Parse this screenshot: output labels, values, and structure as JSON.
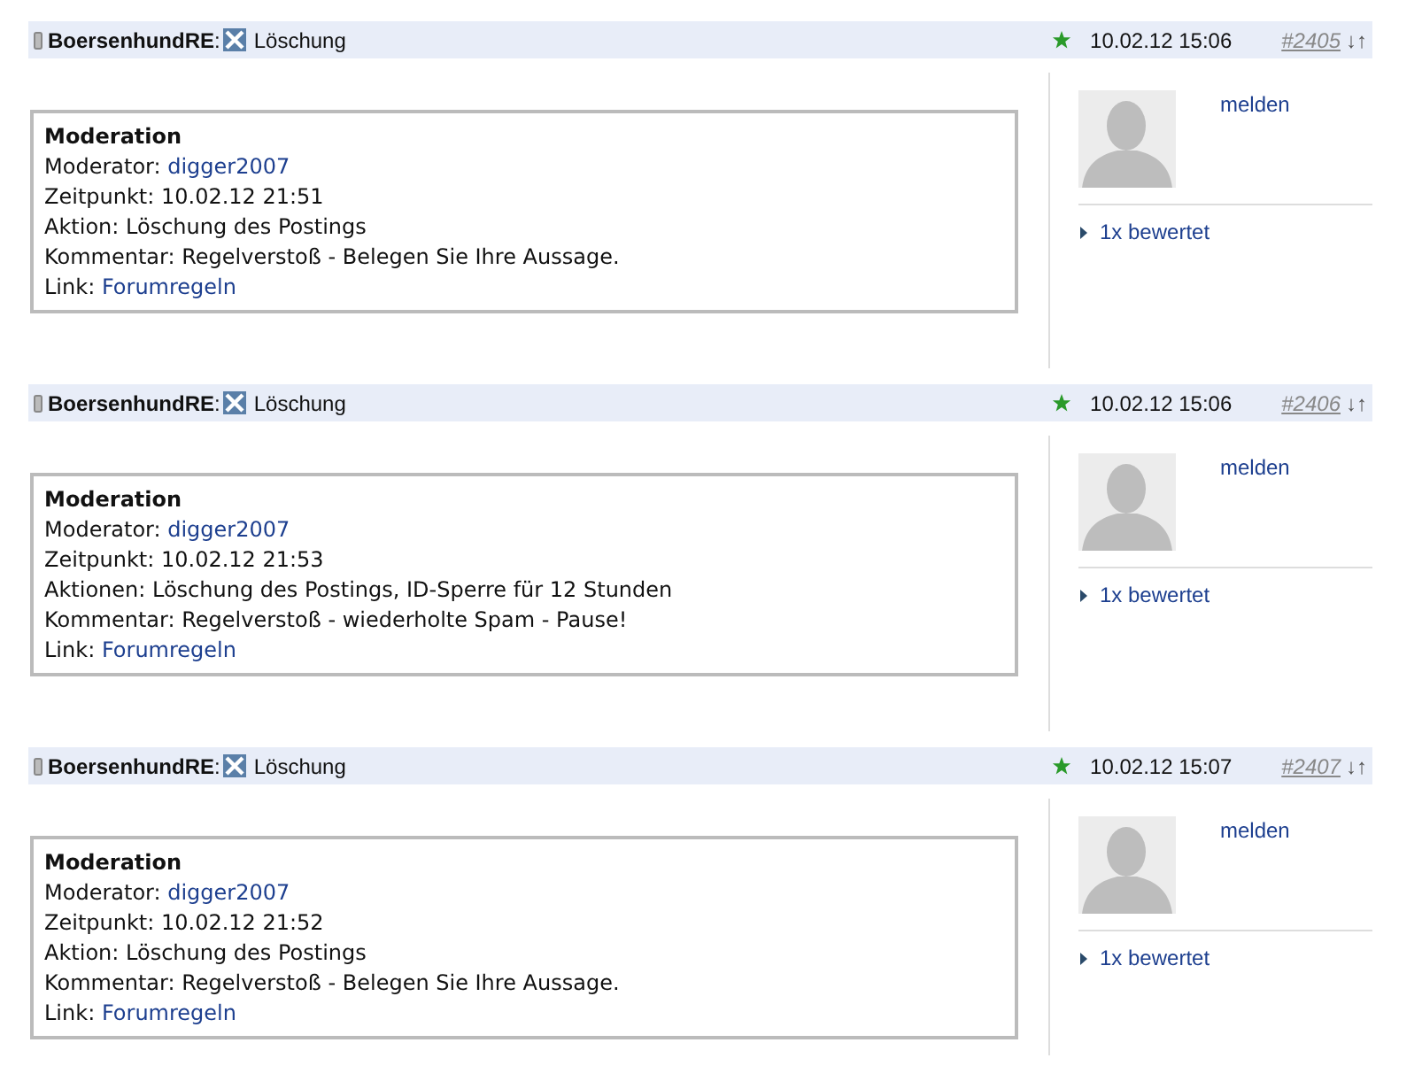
{
  "posts": [
    {
      "author": "**BoersenhundRE**:",
      "title": "Löschung",
      "date": "10.02.12 15:06",
      "number": "#2405",
      "arrows": "↓↑",
      "moderation": {
        "heading": "Moderation",
        "lines": [
          {
            "label": "Moderator: ",
            "link": "digger2007"
          },
          {
            "label": "Zeitpunkt: 10.02.12 21:51"
          },
          {
            "label": "Aktion: Löschung des Postings"
          },
          {
            "label": "Kommentar: Regelverstoß - Belegen Sie Ihre Aussage."
          },
          {
            "label": "Link: ",
            "link": "Forumregeln"
          }
        ]
      },
      "report": "melden",
      "rating": "1x bewertet"
    },
    {
      "author": "**BoersenhundRE**:",
      "title": "Löschung",
      "date": "10.02.12 15:06",
      "number": "#2406",
      "arrows": "↓↑",
      "moderation": {
        "heading": "Moderation",
        "lines": [
          {
            "label": "Moderator: ",
            "link": "digger2007"
          },
          {
            "label": "Zeitpunkt: 10.02.12 21:53"
          },
          {
            "label": "Aktionen: Löschung des Postings, ID-Sperre für 12 Stunden"
          },
          {
            "label": "Kommentar: Regelverstoß - wiederholte Spam - Pause!"
          },
          {
            "label": "Link: ",
            "link": "Forumregeln"
          }
        ]
      },
      "report": "melden",
      "rating": "1x bewertet"
    },
    {
      "author": "**BoersenhundRE**:",
      "title": "Löschung",
      "date": "10.02.12 15:07",
      "number": "#2407",
      "arrows": "↓↑",
      "moderation": {
        "heading": "Moderation",
        "lines": [
          {
            "label": "Moderator: ",
            "link": "digger2007"
          },
          {
            "label": "Zeitpunkt: 10.02.12 21:52"
          },
          {
            "label": "Aktion: Löschung des Postings"
          },
          {
            "label": "Kommentar: Regelverstoß - Belegen Sie Ihre Aussage."
          },
          {
            "label": "Link: ",
            "link": "Forumregeln"
          }
        ]
      },
      "report": "melden",
      "rating": "1x bewertet"
    }
  ]
}
